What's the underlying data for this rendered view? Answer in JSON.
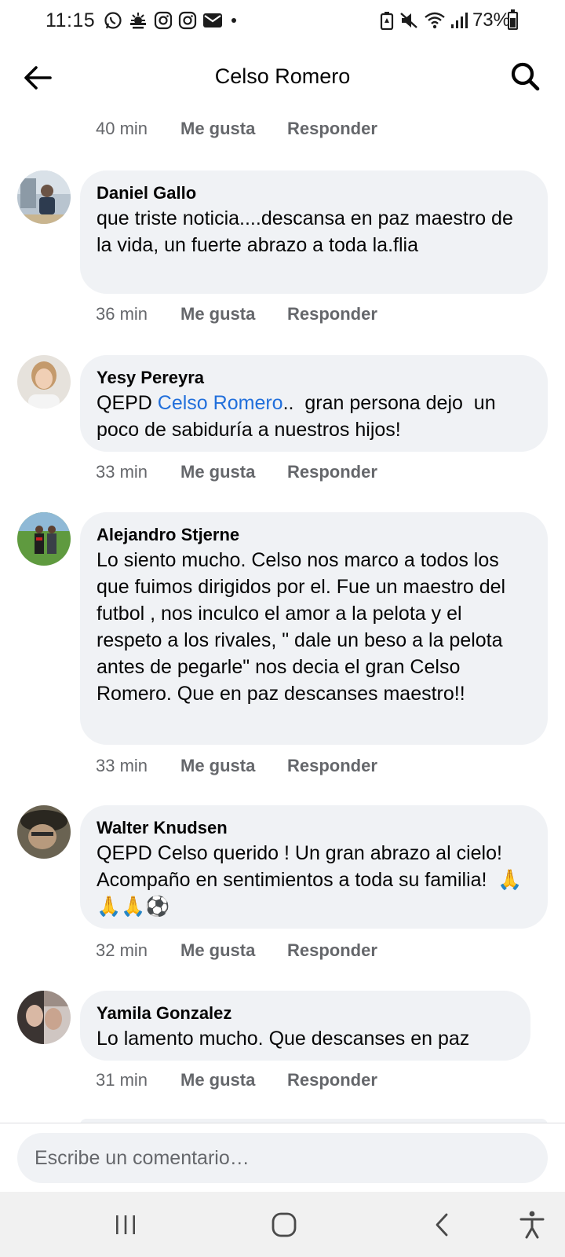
{
  "status_bar": {
    "time": "11:15",
    "battery": "73%",
    "left_icons": [
      "whatsapp-icon",
      "weather-icon",
      "instagram-icon",
      "instagram-icon",
      "mail-icon",
      "dot-icon"
    ],
    "right_icons": [
      "battery-saver-icon",
      "mute-icon",
      "wifi-icon",
      "signal-icon",
      "battery-icon"
    ]
  },
  "header": {
    "title": "Celso Romero"
  },
  "top_actions": {
    "time": "40 min",
    "like": "Me gusta",
    "reply": "Responder"
  },
  "comments": [
    {
      "author": "Daniel Gallo",
      "text": "que triste noticia....descansa en paz maestro de la vida, un fuerte abrazo a toda la.flia",
      "time": "36 min",
      "like": "Me gusta",
      "reply": "Responder"
    },
    {
      "author": "Yesy Pereyra",
      "prefix": "QEPD ",
      "mention": "Celso Romero",
      "text": "..  gran persona dejo  un poco de sabiduría a nuestros hijos!",
      "time": "33 min",
      "like": "Me gusta",
      "reply": "Responder"
    },
    {
      "author": "Alejandro Stjerne",
      "text": "Lo siento mucho. Celso nos marco a todos los que fuimos dirigidos por el. Fue un maestro del futbol , nos inculco el amor a la pelota y el respeto a los rivales, \" dale un beso a la pelota antes de pegarle\" nos decia el gran Celso Romero. Que en paz descanses maestro!!",
      "time": "33 min",
      "like": "Me gusta",
      "reply": "Responder"
    },
    {
      "author": "Walter Knudsen",
      "text": "QEPD Celso querido ! Un gran abrazo al cielo! Acompaño en sentimientos a toda su familia!  🙏🙏🙏⚽",
      "time": "32 min",
      "like": "Me gusta",
      "reply": "Responder"
    },
    {
      "author": "Yamila Gonzalez",
      "text": "Lo lamento mucho. Que descanses en paz",
      "time": "31 min",
      "like": "Me gusta",
      "reply": "Responder"
    }
  ],
  "composer": {
    "placeholder": "Escribe un comentario…"
  },
  "nav": {
    "icons": [
      "recent-apps-icon",
      "home-icon",
      "back-nav-icon",
      "accessibility-icon"
    ]
  },
  "colors": {
    "bubble": "#f0f2f5",
    "mention": "#216fdb",
    "meta": "#65676b",
    "navbar": "#f1f1f1"
  }
}
